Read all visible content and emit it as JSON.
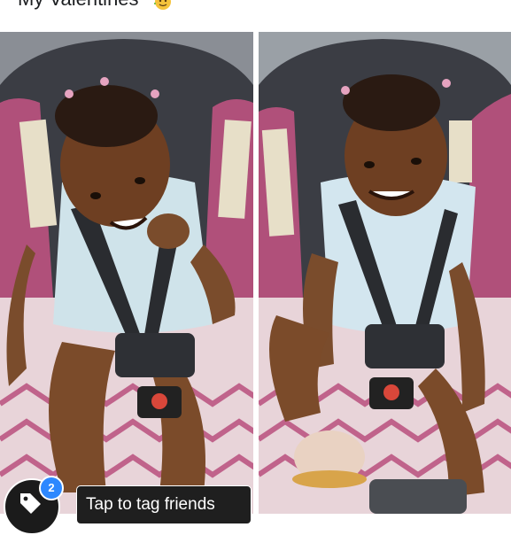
{
  "post": {
    "caption": "My Valentines",
    "caption_emoji": "face-with-party-hat-emoji"
  },
  "photos": [
    {
      "description": "left-photo"
    },
    {
      "description": "right-photo"
    }
  ],
  "tag": {
    "badge_count": "2",
    "tooltip_label": "Tap to tag friends",
    "icon": "tag-icon"
  },
  "colors": {
    "badge": "#2d88ff",
    "tooltip_bg": "#1f1f1f"
  }
}
